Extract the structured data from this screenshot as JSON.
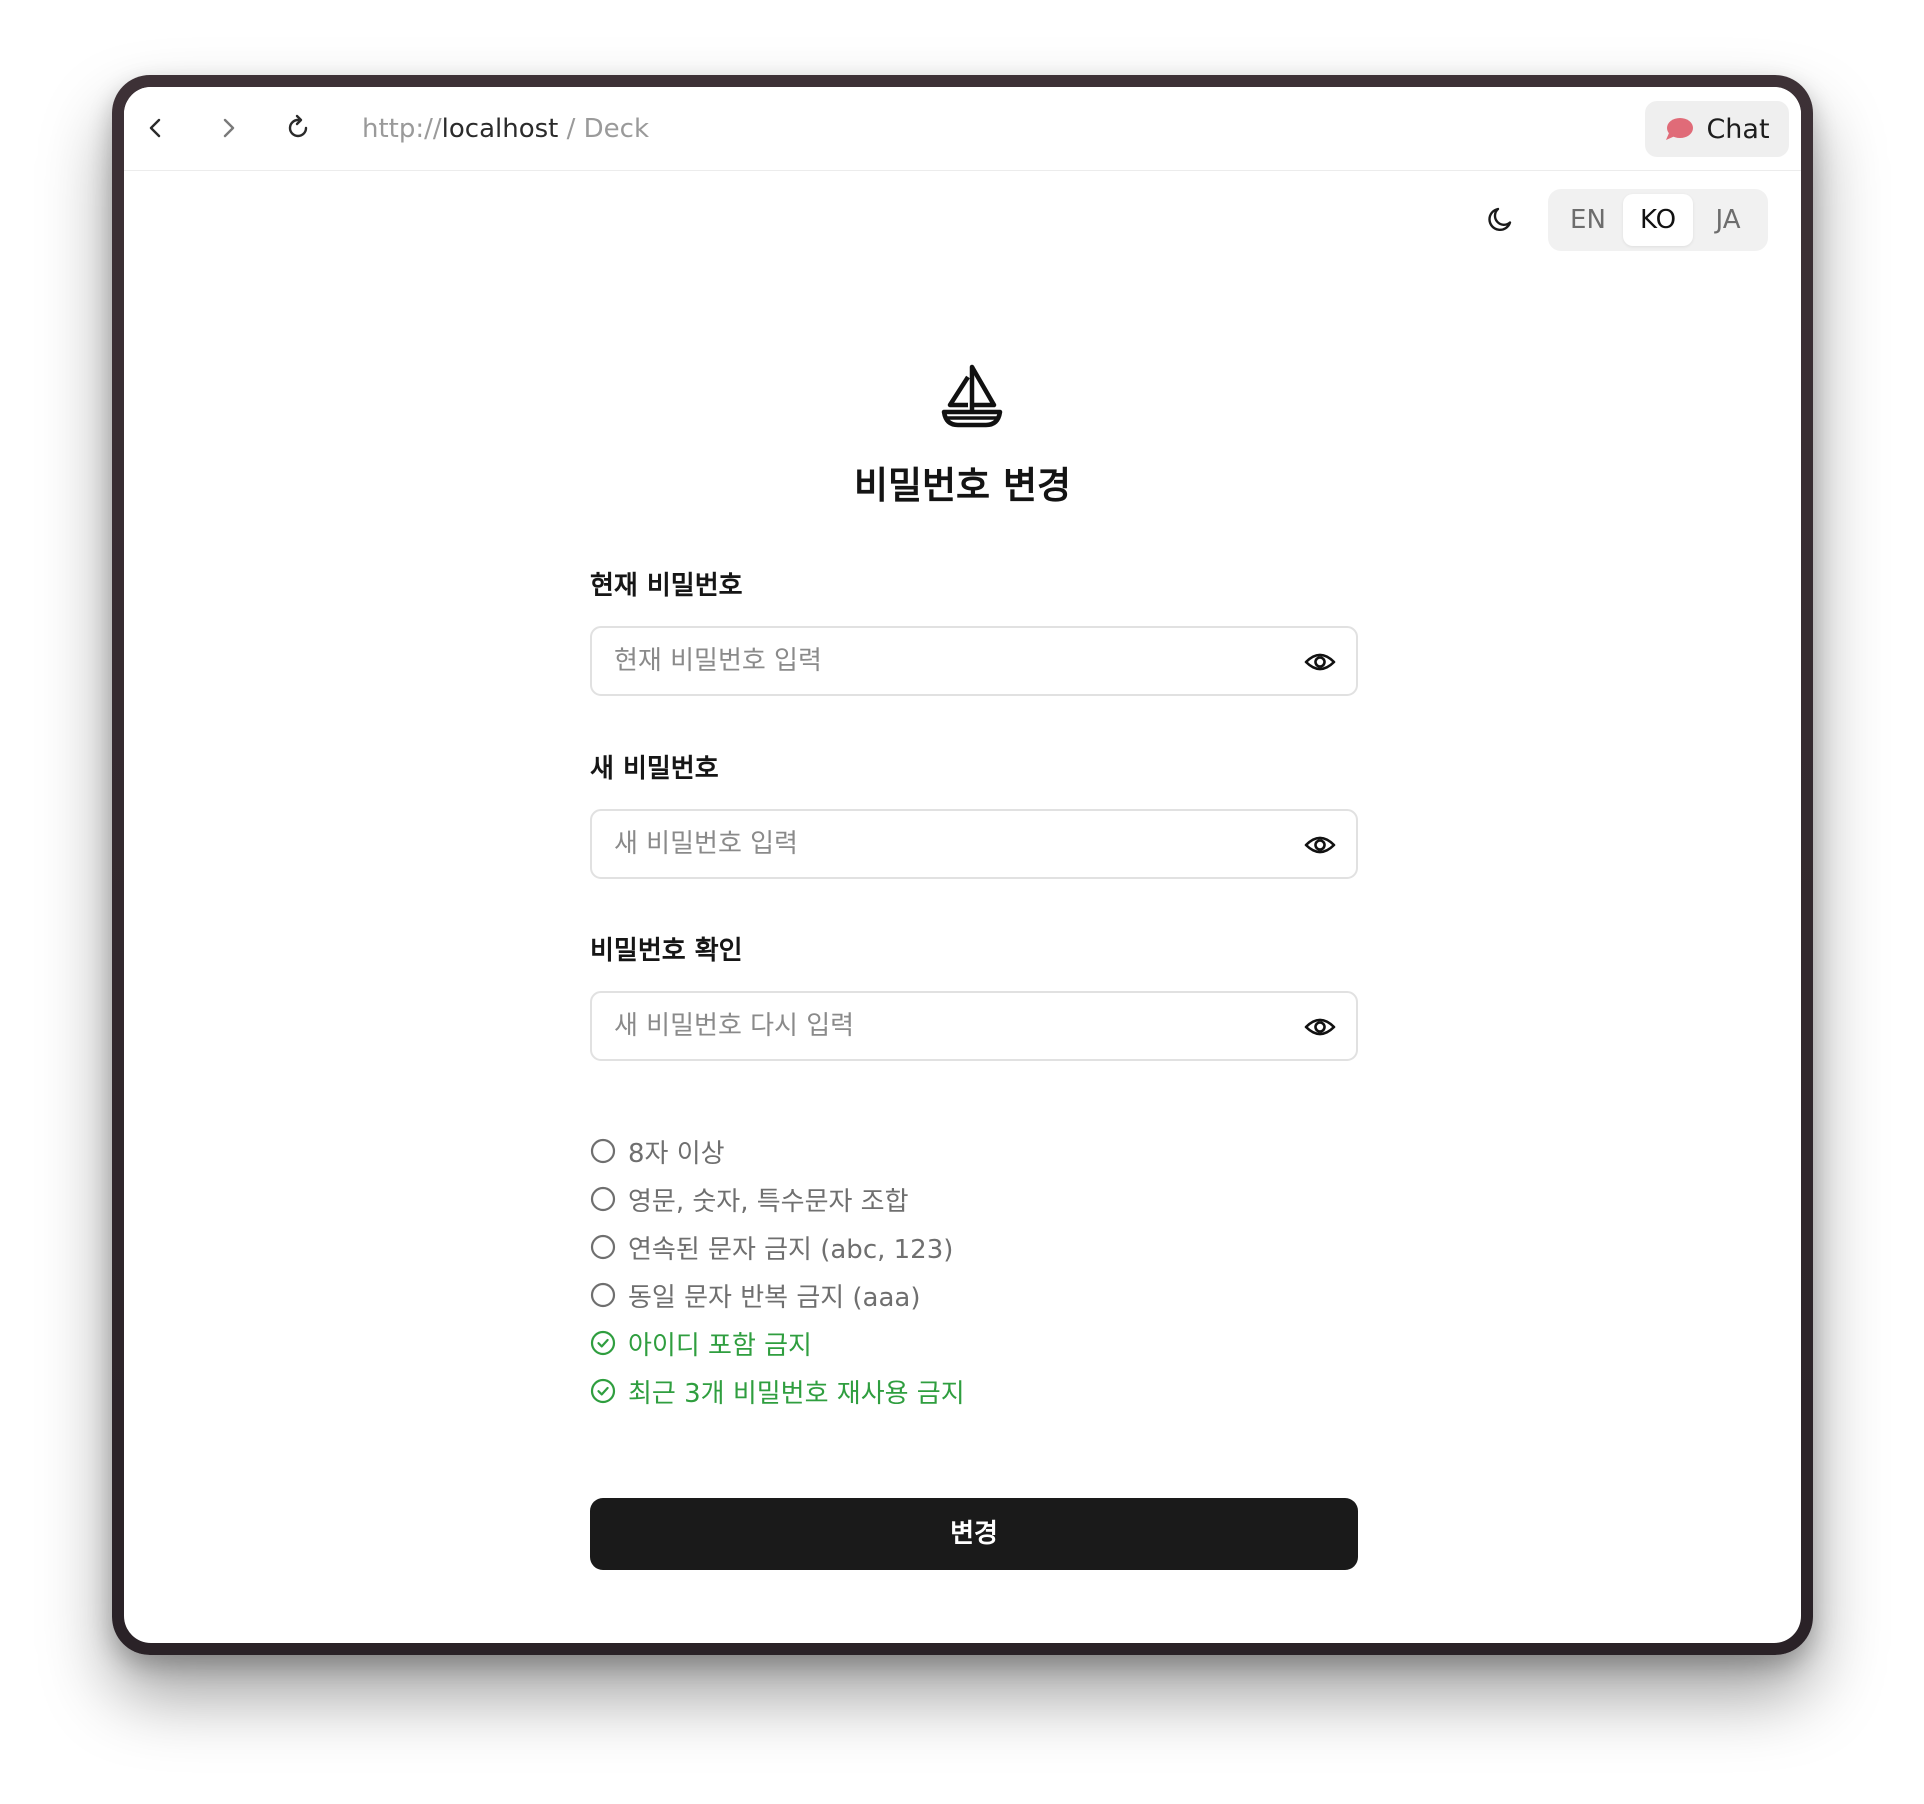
{
  "browser": {
    "url_scheme": "http://",
    "url_host": "localhost",
    "url_path": " / Deck",
    "chat_label": "Chat",
    "chat_icon": "speech-bubble-icon",
    "chat_icon_color": "#e06b78"
  },
  "controls": {
    "theme_icon": "moon-icon",
    "languages": [
      {
        "code": "EN",
        "active": false
      },
      {
        "code": "KO",
        "active": true
      },
      {
        "code": "JA",
        "active": false
      }
    ]
  },
  "form": {
    "logo_icon": "sailboat-icon",
    "title": "비밀번호 변경",
    "fields": [
      {
        "label": "현재 비밀번호",
        "placeholder": "현재 비밀번호 입력",
        "value": ""
      },
      {
        "label": "새 비밀번호",
        "placeholder": "새 비밀번호 입력",
        "value": ""
      },
      {
        "label": "비밀번호 확인",
        "placeholder": "새 비밀번호 다시 입력",
        "value": ""
      }
    ],
    "rules": [
      {
        "text": "8자 이상",
        "satisfied": false
      },
      {
        "text": "영문, 숫자, 특수문자 조합",
        "satisfied": false
      },
      {
        "text": "연속된 문자 금지 (abc, 123)",
        "satisfied": false
      },
      {
        "text": "동일 문자 반복 금지 (aaa)",
        "satisfied": false
      },
      {
        "text": "아이디 포함 금지",
        "satisfied": true
      },
      {
        "text": "최근 3개 비밀번호 재사용 금지",
        "satisfied": true
      }
    ],
    "submit_label": "변경",
    "accent_ok": "#2f9e3f",
    "button_color": "#1a1a1a"
  }
}
